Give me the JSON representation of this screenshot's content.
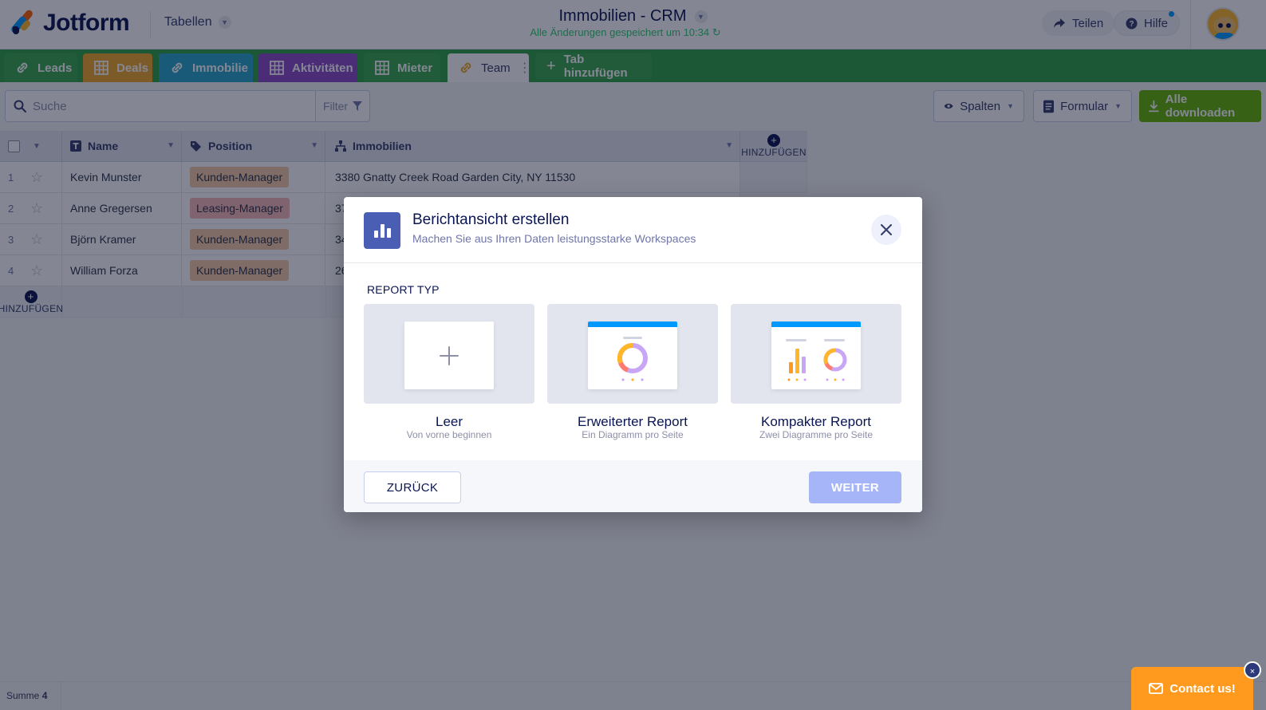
{
  "header": {
    "brand": "Jotform",
    "menu_label": "Tabellen",
    "doc_title": "Immobilien - CRM",
    "saved_status": "Alle Änderungen gespeichert um 10:34",
    "share_label": "Teilen",
    "help_label": "Hilfe"
  },
  "tabs": [
    {
      "label": "Leads",
      "color": "#3aa64d"
    },
    {
      "label": "Deals",
      "color": "#f0a72a"
    },
    {
      "label": "Immobilie",
      "color": "#27a5c9"
    },
    {
      "label": "Aktivitäten",
      "color": "#8c49c7"
    },
    {
      "label": "Mieter",
      "color": "#3aa64d"
    },
    {
      "label": "Team",
      "color": "#ffffff"
    },
    {
      "label": "Tab hinzufügen",
      "color": "#3aa64d"
    }
  ],
  "toolbar": {
    "search_placeholder": "Suche",
    "filter_label": "Filter",
    "columns_label": "Spalten",
    "form_label": "Formular",
    "download_label": "Alle downloaden"
  },
  "grid": {
    "columns": [
      "Name",
      "Position",
      "Immobilien"
    ],
    "add_column_label": "HINZUFÜGEN",
    "add_row_label": "HINZUFÜGEN",
    "rows": [
      {
        "num": "1",
        "name": "Kevin Munster",
        "position": "Kunden-Manager",
        "property": "3380 Gnatty Creek Road Garden City, NY 11530"
      },
      {
        "num": "2",
        "name": "Anne Gregersen",
        "position": "Leasing-Manager",
        "property": "37"
      },
      {
        "num": "3",
        "name": "Björn Kramer",
        "position": "Kunden-Manager",
        "property": "34"
      },
      {
        "num": "4",
        "name": "William Forza",
        "position": "Kunden-Manager",
        "property": "26"
      }
    ]
  },
  "footer": {
    "sum_label": "Summe",
    "sum_value": "4",
    "contact_label": "Contact us!",
    "contact_close": "×"
  },
  "modal": {
    "title": "Berichtansicht erstellen",
    "subtitle": "Machen Sie aus Ihren Daten leistungsstarke Workspaces",
    "section_label": "REPORT TYP",
    "options": [
      {
        "title": "Leer",
        "subtitle": "Von vorne beginnen"
      },
      {
        "title": "Erweiterter Report",
        "subtitle": "Ein Diagramm pro Seite"
      },
      {
        "title": "Kompakter Report",
        "subtitle": "Zwei Diagramme pro Seite"
      }
    ],
    "back_label": "ZURÜCK",
    "next_label": "WEITER"
  }
}
